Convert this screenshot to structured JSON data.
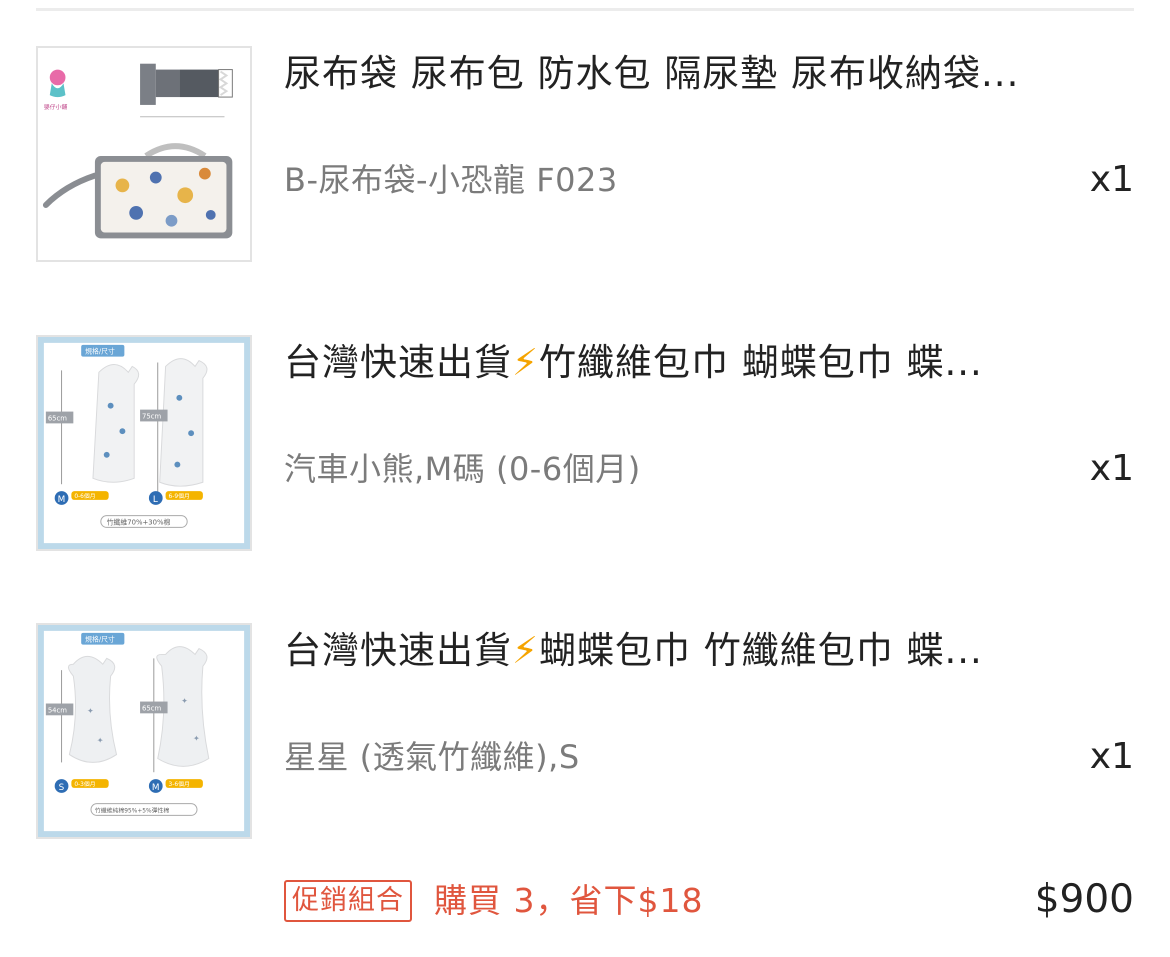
{
  "items": [
    {
      "title": "尿布袋 尿布包 防水包 隔尿墊 尿布收納袋 ...",
      "title_prefix": "",
      "title_rest": "尿布袋 尿布包 防水包 隔尿墊 尿布收納袋...",
      "variant": "B-尿布袋-小恐龍 F023",
      "qty": "x1",
      "thumb_label": "嬰仔小舖"
    },
    {
      "title_prefix": "台灣快速出貨",
      "title_rest": "竹纖維包巾 蝴蝶包巾 蝶...",
      "variant": "汽車小熊,M碼 (0-6個月)",
      "qty": "x1",
      "thumb_tag": "規格/尺寸",
      "thumb_size_a": "65cm",
      "thumb_size_b": "75cm",
      "thumb_badge_a": "0-6個月",
      "thumb_badge_b": "6-9個月",
      "thumb_letter_a": "M",
      "thumb_letter_b": "L",
      "thumb_material": "竹纖維70%+30%棉"
    },
    {
      "title_prefix": "台灣快速出貨",
      "title_rest": "蝴蝶包巾 竹纖維包巾 蝶...",
      "variant": "星星 (透氣竹纖維),S",
      "qty": "x1",
      "thumb_tag": "規格/尺寸",
      "thumb_size_a": "54cm",
      "thumb_size_b": "65cm",
      "thumb_badge_a": "0-3個月",
      "thumb_badge_b": "3-6個月",
      "thumb_letter_a": "S",
      "thumb_letter_b": "M",
      "thumb_material": "竹纖維純棉95%+5%彈性棉"
    }
  ],
  "bolt_icon": "⚡",
  "footer": {
    "promo_badge": "促銷組合",
    "promo_text": "購買 3，省下$18",
    "total": "$900"
  },
  "colors": {
    "promo": "#e0563e",
    "bolt": "#f5a400",
    "variant_text": "#7b7b7b"
  }
}
